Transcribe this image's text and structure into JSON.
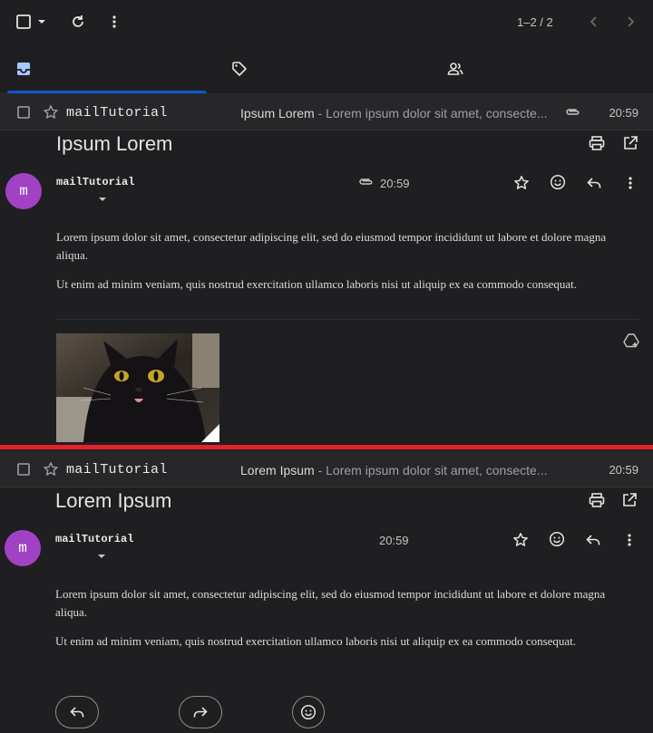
{
  "toolbar": {
    "pager": "1–2 / 2"
  },
  "tabs": [
    {
      "icon": "inbox-icon"
    },
    {
      "icon": "tag-icon"
    },
    {
      "icon": "people-icon"
    }
  ],
  "threads": [
    {
      "row": {
        "sender": "mailTutorial",
        "subject": "Ipsum Lorem",
        "snippet": " - Lorem ipsum dolor sit amet, consecte...",
        "time": "20:59",
        "has_attachment": true
      },
      "title": "Ipsum Lorem",
      "avatar_letter": "m",
      "from": "mailTutorial",
      "time": "20:59",
      "paragraphs": [
        "Lorem ipsum dolor sit amet, consectetur adipiscing elit, sed do eiusmod tempor incididunt ut labore et dolore magna aliqua.",
        "Ut enim ad minim veniam, quis nostrud exercitation ullamco laboris nisi ut aliquip ex ea commodo consequat."
      ]
    },
    {
      "row": {
        "sender": "mailTutorial",
        "subject": "Lorem Ipsum",
        "snippet": " - Lorem ipsum dolor sit amet, consecte...",
        "time": "20:59",
        "has_attachment": false
      },
      "title": "Lorem Ipsum",
      "avatar_letter": "m",
      "from": "mailTutorial",
      "time": "20:59",
      "paragraphs": [
        "Lorem ipsum dolor sit amet, consectetur adipiscing elit, sed do eiusmod tempor incididunt ut labore et dolore magna aliqua.",
        "Ut enim ad minim veniam, quis nostrud exercitation ullamco laboris nisi ut aliquip ex ea commodo consequat."
      ]
    }
  ],
  "colors": {
    "accent": "#0b57d0",
    "avatar": "#a142c4",
    "separator": "#e5212b",
    "background": "#1f1f21"
  }
}
